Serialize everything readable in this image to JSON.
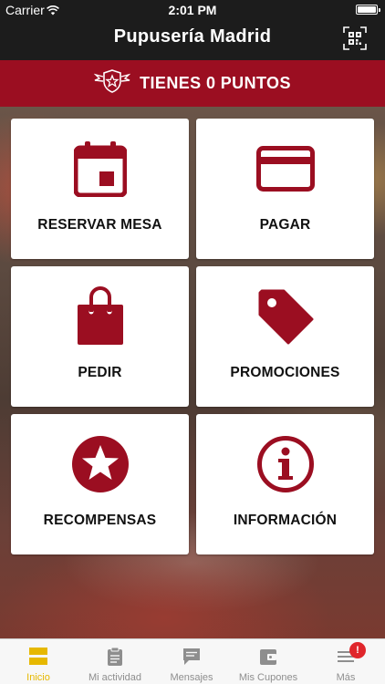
{
  "status_bar": {
    "carrier": "Carrier",
    "time": "2:01 PM"
  },
  "nav": {
    "title": "Pupusería Madrid",
    "qr_icon": "qr-code-icon"
  },
  "points_banner": {
    "text": "TIENES 0 PUNTOS",
    "icon": "badge-star-icon"
  },
  "tiles": [
    {
      "label": "RESERVAR MESA",
      "icon": "calendar-icon"
    },
    {
      "label": "PAGAR",
      "icon": "credit-card-icon"
    },
    {
      "label": "PEDIR",
      "icon": "shopping-bag-icon"
    },
    {
      "label": "PROMOCIONES",
      "icon": "tag-icon"
    },
    {
      "label": "RECOMPENSAS",
      "icon": "star-icon"
    },
    {
      "label": "INFORMACIÓN",
      "icon": "info-icon"
    }
  ],
  "tabbar": {
    "active": "Inicio",
    "badge": "!",
    "items": [
      {
        "label": "Inicio",
        "icon": "home-icon"
      },
      {
        "label": "Mi actividad",
        "icon": "clipboard-icon"
      },
      {
        "label": "Mensajes",
        "icon": "message-icon"
      },
      {
        "label": "Mis Cupones",
        "icon": "wallet-icon"
      },
      {
        "label": "Más",
        "icon": "menu-icon"
      }
    ]
  },
  "colors": {
    "brand_red": "#9b0e21",
    "tile_icon": "#9b0e21",
    "active_tab": "#e6b800",
    "badge": "#e0262b"
  }
}
